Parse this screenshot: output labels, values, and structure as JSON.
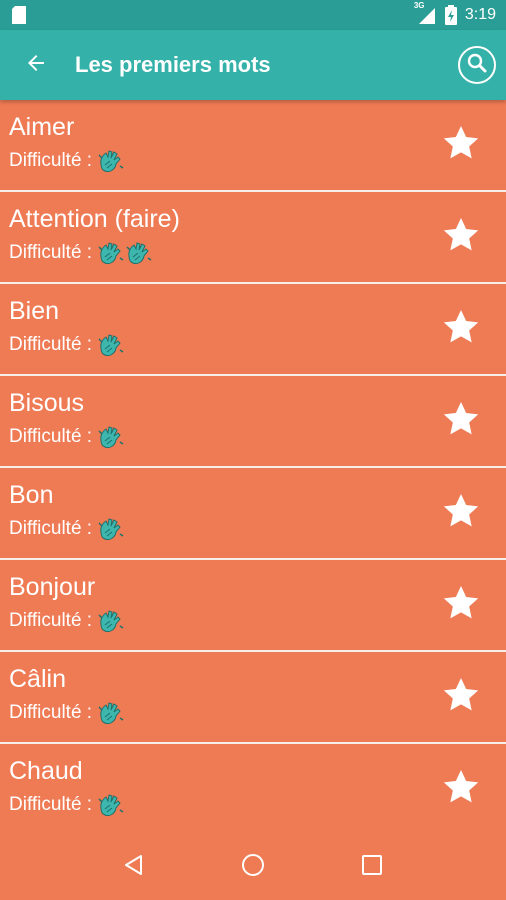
{
  "status_bar": {
    "time": "3:19",
    "network": "3G",
    "icons": [
      "sd-card-icon",
      "signal-icon",
      "battery-icon"
    ]
  },
  "app_bar": {
    "title": "Les premiers mots",
    "back_icon": "arrow-left-icon",
    "search_icon": "search-icon"
  },
  "list": {
    "difficulty_label": "Difficulté :",
    "items": [
      {
        "word": "Aimer",
        "difficulty": 1,
        "difficulty_label": "Difficulté :"
      },
      {
        "word": "Attention (faire)",
        "difficulty": 2,
        "difficulty_label": "Difficulté :"
      },
      {
        "word": "Bien",
        "difficulty": 1,
        "difficulty_label": "Difficulté :"
      },
      {
        "word": "Bisous",
        "difficulty": 1,
        "difficulty_label": "Difficulté :"
      },
      {
        "word": "Bon",
        "difficulty": 1,
        "difficulty_label": "Difficulté :"
      },
      {
        "word": "Bonjour",
        "difficulty": 1,
        "difficulty_label": "Difficulté :"
      },
      {
        "word": "Câlin",
        "difficulty": 1,
        "difficulty_label": "Difficulté :"
      },
      {
        "word": "Chaud",
        "difficulty": 1,
        "difficulty_label": "Difficulté :"
      }
    ]
  },
  "nav_bar": {
    "icons": [
      "back-triangle-icon",
      "home-circle-icon",
      "recents-square-icon"
    ]
  },
  "colors": {
    "status_bar": "#2A9E96",
    "app_bar": "#34B1A8",
    "list_background": "#EF7B55",
    "text": "#FFFFFF",
    "hand_icon": "#3DB6AE"
  }
}
